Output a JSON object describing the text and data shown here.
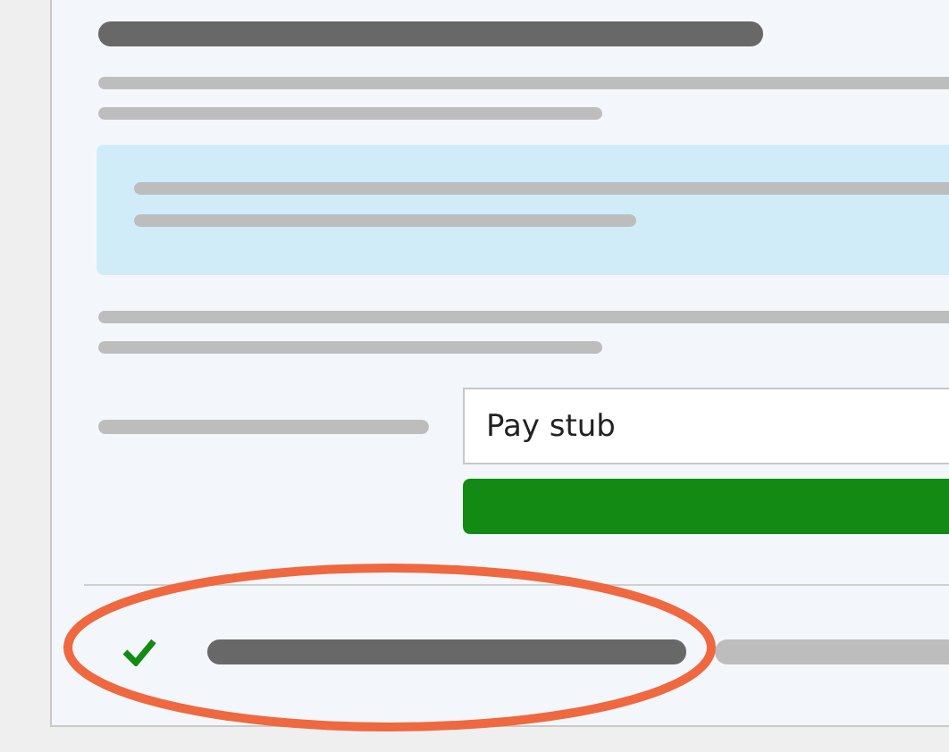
{
  "form": {
    "document_field": {
      "value": "Pay stub"
    }
  },
  "status": {
    "done": true
  }
}
